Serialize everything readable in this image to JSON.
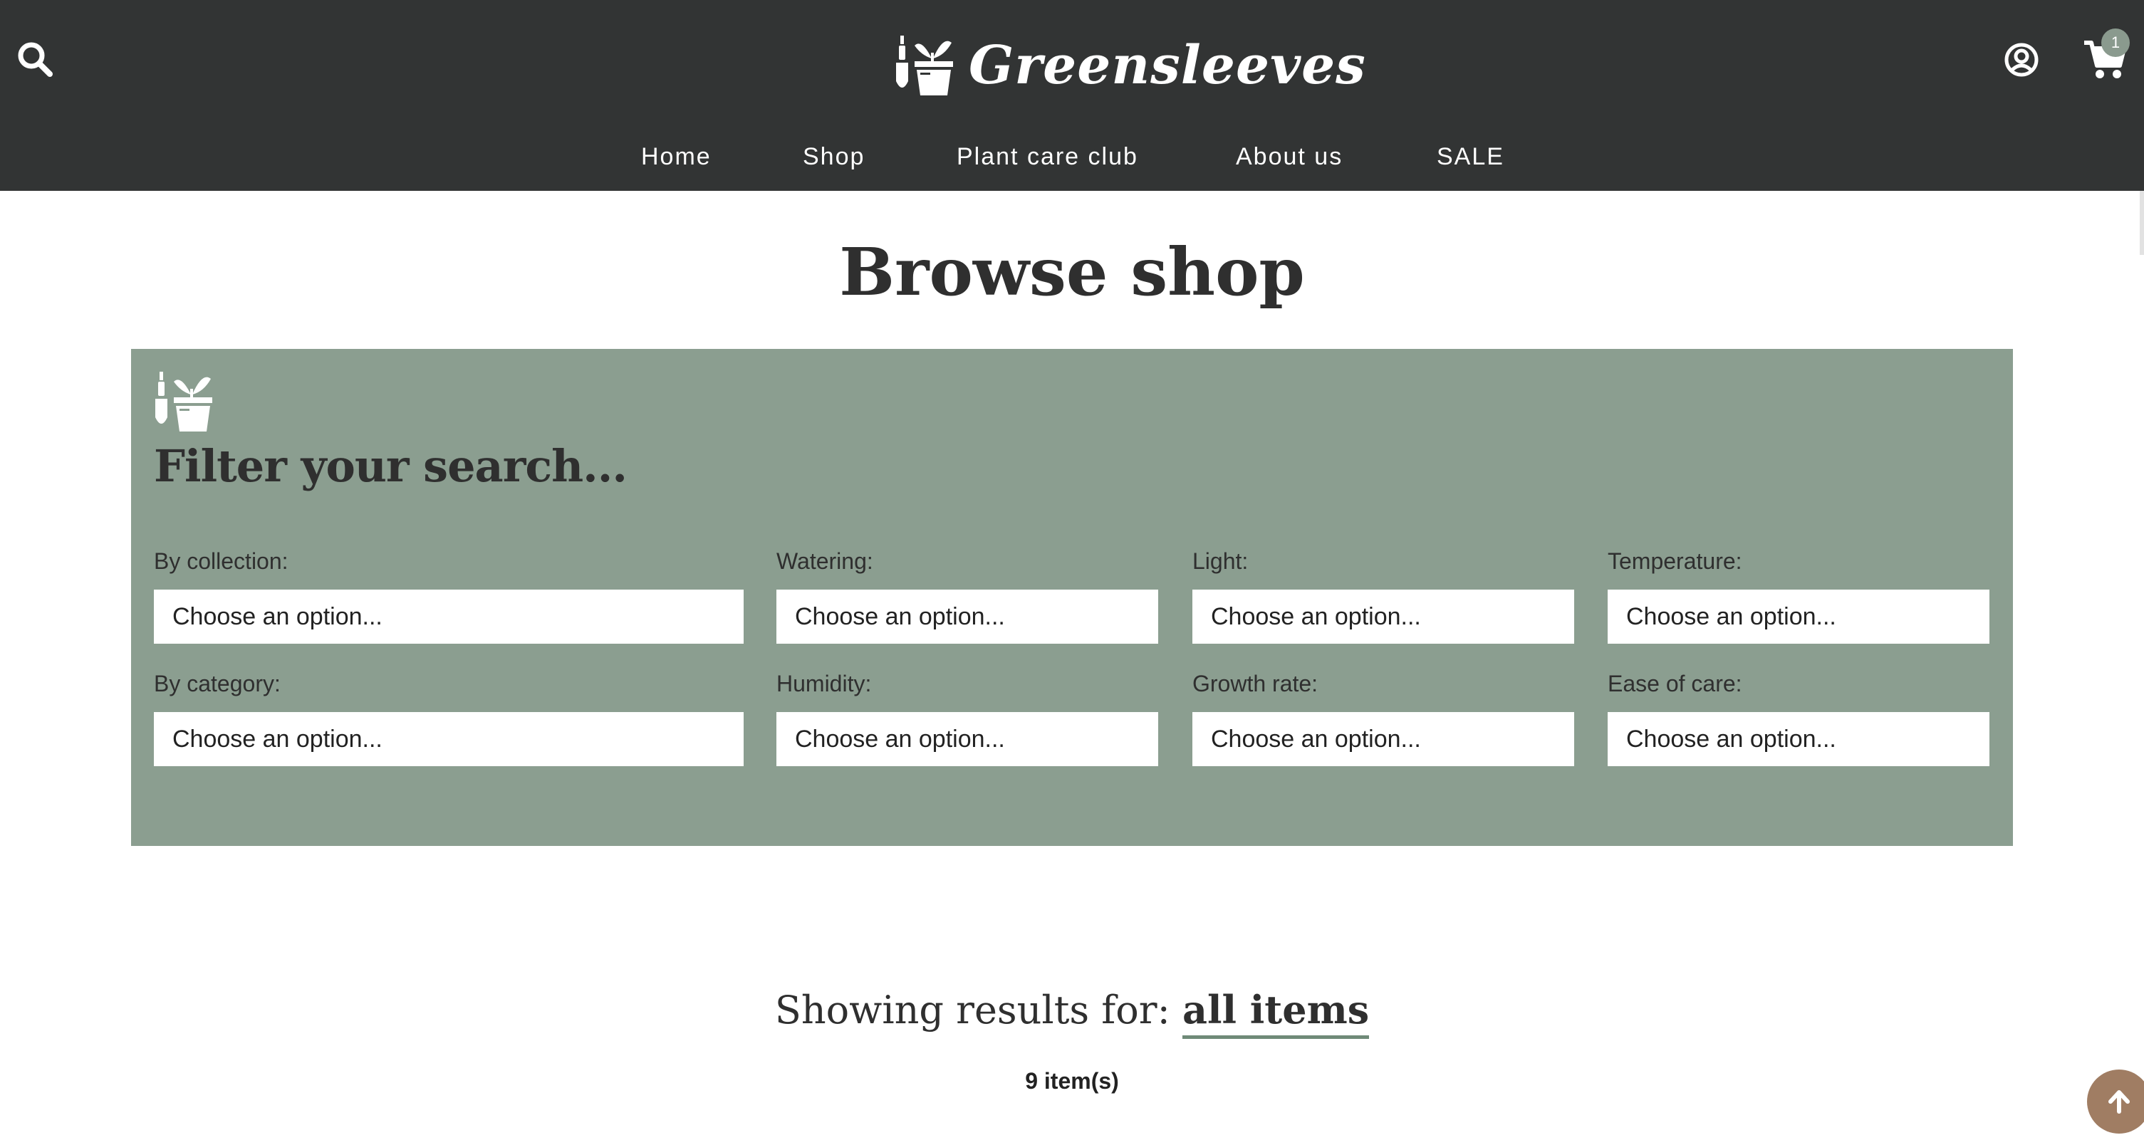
{
  "header": {
    "brand_name": "Greensleeves",
    "search_icon": "search-icon",
    "account_icon": "user-circle-icon",
    "cart_icon": "shopping-cart-icon",
    "cart_count": "1",
    "background": "#323434"
  },
  "nav": {
    "items": [
      {
        "label": "Home"
      },
      {
        "label": "Shop"
      },
      {
        "label": "Plant care club"
      },
      {
        "label": "About us"
      },
      {
        "label": "SALE"
      }
    ]
  },
  "page": {
    "title": "Browse shop"
  },
  "filters": {
    "heading": "Filter your search...",
    "panel_color": "#8b9e90",
    "fields": [
      {
        "label": "By collection:",
        "value": "Choose an option..."
      },
      {
        "label": "Watering:",
        "value": "Choose an option..."
      },
      {
        "label": "Light:",
        "value": "Choose an option..."
      },
      {
        "label": "Temperature:",
        "value": "Choose an option..."
      },
      {
        "label": "By category:",
        "value": "Choose an option..."
      },
      {
        "label": "Humidity:",
        "value": "Choose an option..."
      },
      {
        "label": "Growth rate:",
        "value": "Choose an option..."
      },
      {
        "label": "Ease of care:",
        "value": "Choose an option..."
      }
    ]
  },
  "results": {
    "prefix": "Showing results for:",
    "query": "all items",
    "count": "9 item(s)"
  },
  "scroll_top": {
    "icon": "arrow-up-icon",
    "color": "#a07d63"
  }
}
